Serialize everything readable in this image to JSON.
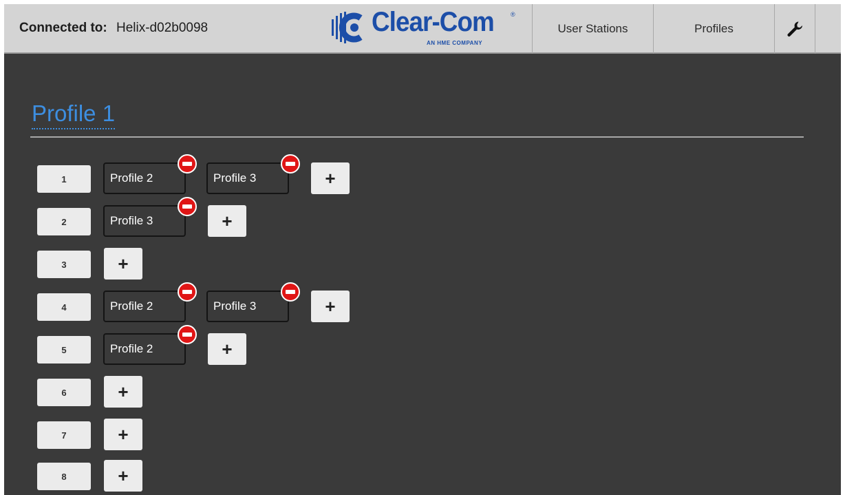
{
  "header": {
    "connected_label": "Connected to:",
    "connected_value": "Helix-d02b0098",
    "logo_text": "Clear-Com",
    "logo_tagline": "AN HME COMPANY",
    "logo_reg": "®",
    "tabs": [
      {
        "label": "User Stations"
      },
      {
        "label": "Profiles"
      }
    ],
    "settings_icon": "wrench-icon"
  },
  "page": {
    "title": "Profile 1"
  },
  "rows": [
    {
      "number": "1",
      "profiles": [
        "Profile 2",
        "Profile 3"
      ]
    },
    {
      "number": "2",
      "profiles": [
        "Profile 3"
      ]
    },
    {
      "number": "3",
      "profiles": []
    },
    {
      "number": "4",
      "profiles": [
        "Profile 2",
        "Profile 3"
      ]
    },
    {
      "number": "5",
      "profiles": [
        "Profile 2"
      ]
    },
    {
      "number": "6",
      "profiles": []
    },
    {
      "number": "7",
      "profiles": []
    },
    {
      "number": "8",
      "profiles": []
    }
  ],
  "icons": {
    "add": "+",
    "remove": "remove-icon"
  },
  "colors": {
    "accent": "#3d8ee0",
    "brand": "#1c4ea8",
    "remove": "#e01616",
    "background": "#3a3a3a",
    "header": "#d4d4d4"
  }
}
